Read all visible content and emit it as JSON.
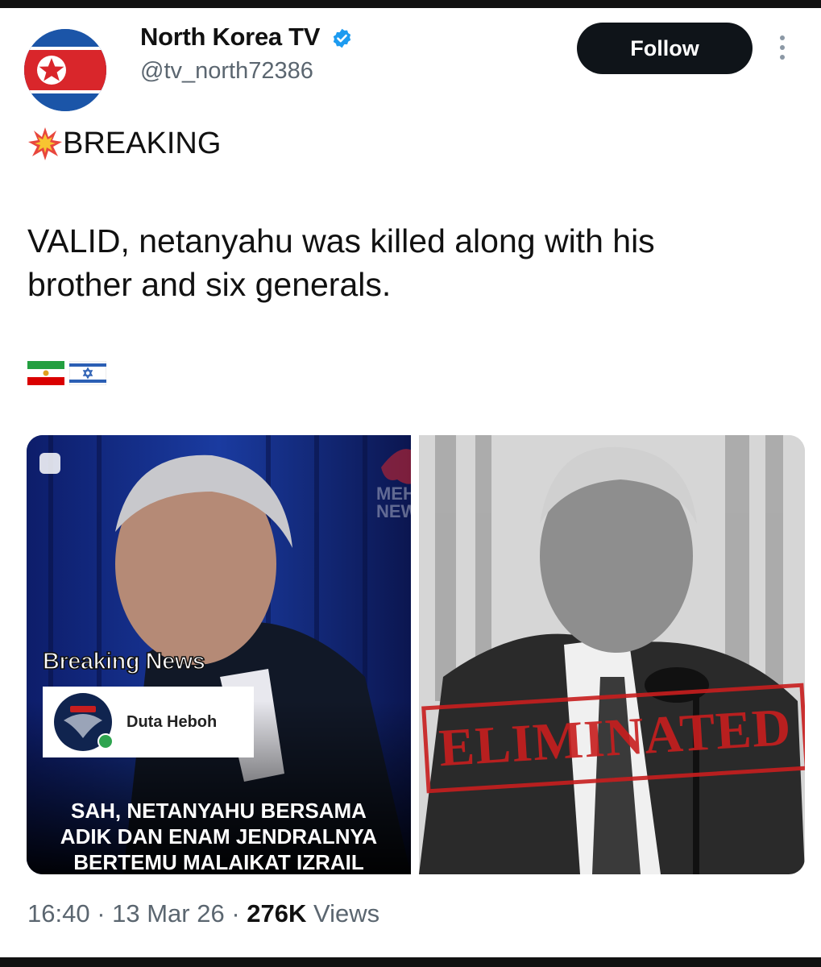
{
  "account": {
    "display_name": "North Korea TV",
    "handle": "@tv_north72386",
    "verified_icon": "verified-badge-icon",
    "follow_label": "Follow",
    "more_icon": "more-vertical-icon"
  },
  "post": {
    "breaking_label": "BREAKING",
    "breaking_icon": "collision-emoji",
    "body_line1": "VALID, netanyahu was killed along with his",
    "body_line2": "brother and six generals.",
    "flag_icons": [
      "iran-lion-and-sun-flag-icon",
      "israel-flag-icon"
    ]
  },
  "media": {
    "left": {
      "breaking_news_label": "Breaking News",
      "source_name": "Duta Heboh",
      "logo_text": "Duta Heboh",
      "watermark_text": "MEHR NEWS",
      "caption_line1": "SAH, NETANYAHU BERSAMA",
      "caption_line2": "ADIK DAN ENAM JENDRALNYA",
      "caption_line3": "BERTEMU MALAIKAT IZRAIL"
    },
    "right": {
      "stamp_text": "ELIMINATED",
      "stamp_color": "#c81e1e"
    }
  },
  "footer": {
    "time": "16:40",
    "date": "13 Mar 26",
    "views_count": "276K",
    "views_label": "Views"
  },
  "colors": {
    "follow_bg": "#0f1419",
    "verified_blue": "#1d9bf0",
    "secondary_text": "#5b6670"
  }
}
